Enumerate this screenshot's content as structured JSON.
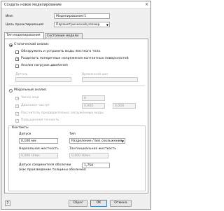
{
  "window": {
    "title": "Создать новое моделирование",
    "close_glyph": "×"
  },
  "name_field": {
    "label": "Имя:",
    "value": "Моделирование:1"
  },
  "purpose_field": {
    "label": "Цель проектирования:",
    "value": "Параметрический размер"
  },
  "tabs": [
    {
      "label": "Тип моделирования"
    },
    {
      "label": "Состояние модели"
    }
  ],
  "static": {
    "radio_label": "Статический анализ",
    "options": [
      {
        "label": "Обнаружить и устранить моды жесткого тела",
        "checked": false
      },
      {
        "label": "Разделить поперечные напряжения контактных поверхностей",
        "checked": true
      },
      {
        "label": "Анализ нагрузок движения",
        "checked": false
      }
    ],
    "part_label": "Деталь",
    "time_step_label": "Временной шаг"
  },
  "modal": {
    "radio_label": "Модальный анализ",
    "mode_count_label": "Число мод",
    "mode_count_value": "8",
    "freq_range_label": "Диапазон частот",
    "freq_from": "0,000",
    "freq_dash": "-",
    "freq_to": "0,000",
    "prestressed_label": "Рассчитать предварительно загруженные моды",
    "precision_label": "Повышенная точность"
  },
  "contacts": {
    "title": "Контакты",
    "tolerance_label": "Допуск",
    "tolerance_value": "0,100 мм",
    "type_label": "Тип",
    "type_value": "Разделение / Без скольжения",
    "normal_stiffness_label": "Нормальная жесткость",
    "normal_stiffness_value": "0,000 Н/мм",
    "tangential_stiffness_label": "Тангенциальная жесткость",
    "tangential_stiffness_value": "0,000 Н/мм",
    "shell_tolerance_label": "Допуск соединителя оболочки",
    "shell_tolerance_note": "(как произведение толщины оболочки)",
    "shell_tolerance_value": "1,750"
  },
  "buttons": {
    "help": "?",
    "reset": "Сброс",
    "ok": "OK",
    "cancel": "Отмена"
  }
}
